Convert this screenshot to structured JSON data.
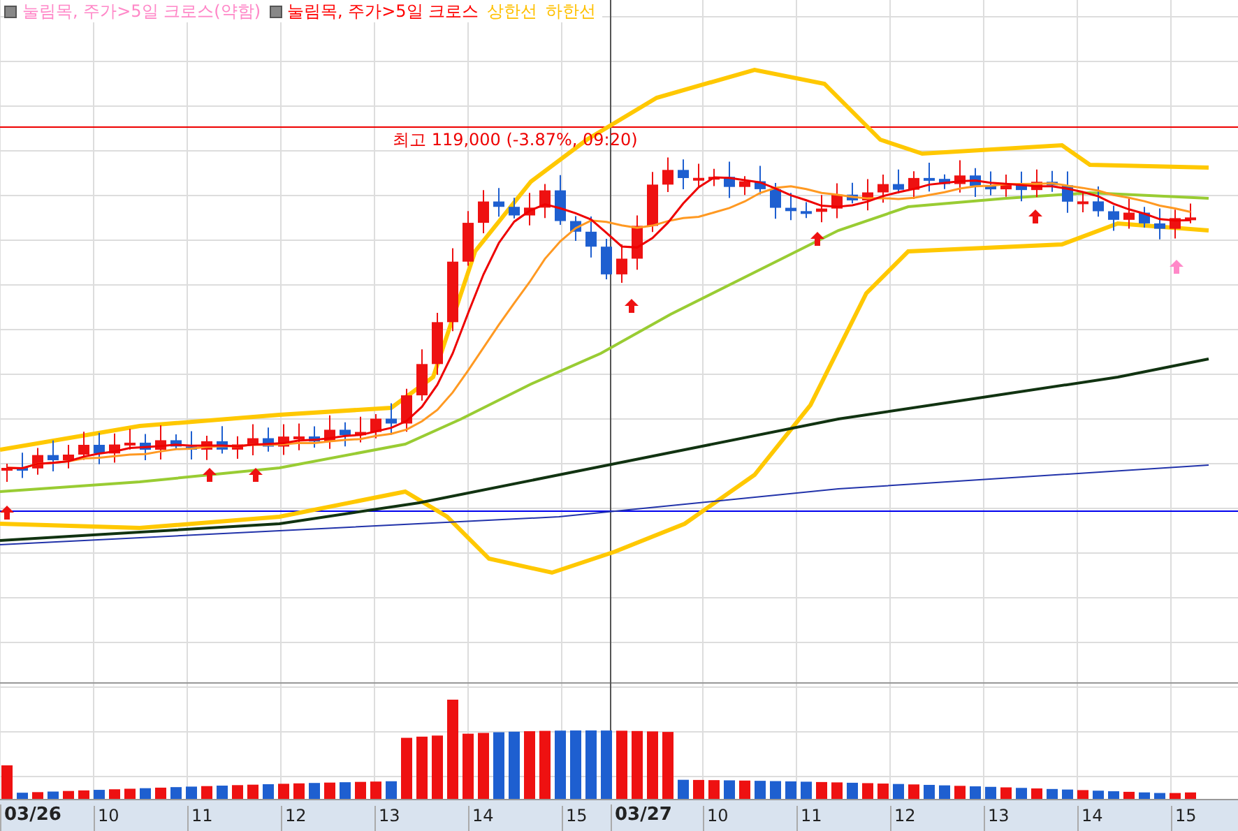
{
  "legend": [
    {
      "label": "눌림목, 주가>5일 크로스(약함)",
      "color": "#ff88c8",
      "marker": true
    },
    {
      "label": "눌림목, 주가>5일 크로스",
      "color": "#ff0000",
      "marker": true
    },
    {
      "label": "상한선",
      "color": "#ffc000",
      "marker": false
    },
    {
      "label": "하한선",
      "color": "#ffc000",
      "marker": false
    }
  ],
  "high_label": "최고 119,000 (-3.87%, 09:20)",
  "x_axis": [
    {
      "label": "03/26",
      "kind": "date"
    },
    {
      "label": "10",
      "kind": "hour"
    },
    {
      "label": "11",
      "kind": "hour"
    },
    {
      "label": "12",
      "kind": "hour"
    },
    {
      "label": "13",
      "kind": "hour"
    },
    {
      "label": "14",
      "kind": "hour"
    },
    {
      "label": "15",
      "kind": "hour"
    },
    {
      "label": "03/27",
      "kind": "date"
    },
    {
      "label": "10",
      "kind": "hour"
    },
    {
      "label": "11",
      "kind": "hour"
    },
    {
      "label": "12",
      "kind": "hour"
    },
    {
      "label": "13",
      "kind": "hour"
    },
    {
      "label": "14",
      "kind": "hour"
    },
    {
      "label": "15",
      "kind": "hour"
    }
  ]
}
